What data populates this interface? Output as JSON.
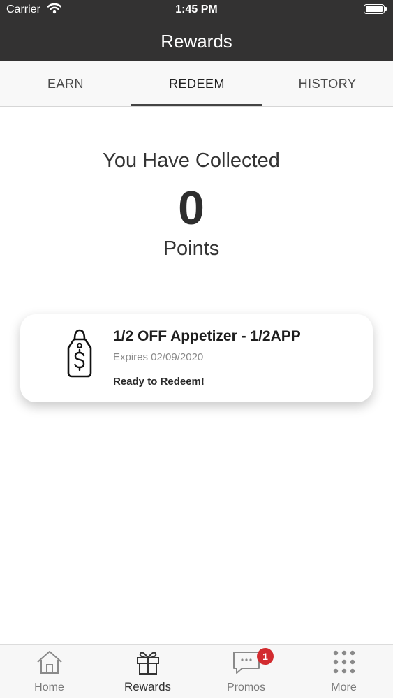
{
  "status_bar": {
    "carrier": "Carrier",
    "time": "1:45 PM"
  },
  "header": {
    "title": "Rewards"
  },
  "tabs": [
    {
      "label": "EARN",
      "active": false
    },
    {
      "label": "REDEEM",
      "active": true
    },
    {
      "label": "HISTORY",
      "active": false
    }
  ],
  "points": {
    "heading": "You Have Collected",
    "value": "0",
    "unit": "Points"
  },
  "rewards": [
    {
      "title": "1/2 OFF Appetizer - 1/2APP",
      "expiry": "Expires 02/09/2020",
      "status": "Ready to Redeem!",
      "icon": "price-tag-dollar-icon"
    }
  ],
  "bottom_nav": {
    "items": [
      {
        "label": "Home",
        "icon": "home-icon",
        "active": false
      },
      {
        "label": "Rewards",
        "icon": "gift-icon",
        "active": true
      },
      {
        "label": "Promos",
        "icon": "chat-bubble-icon",
        "active": false,
        "badge": "1"
      },
      {
        "label": "More",
        "icon": "grid-dots-icon",
        "active": false
      }
    ]
  },
  "colors": {
    "header_bg": "#333232",
    "badge": "#d22b2f",
    "tab_underline": "#444444"
  }
}
